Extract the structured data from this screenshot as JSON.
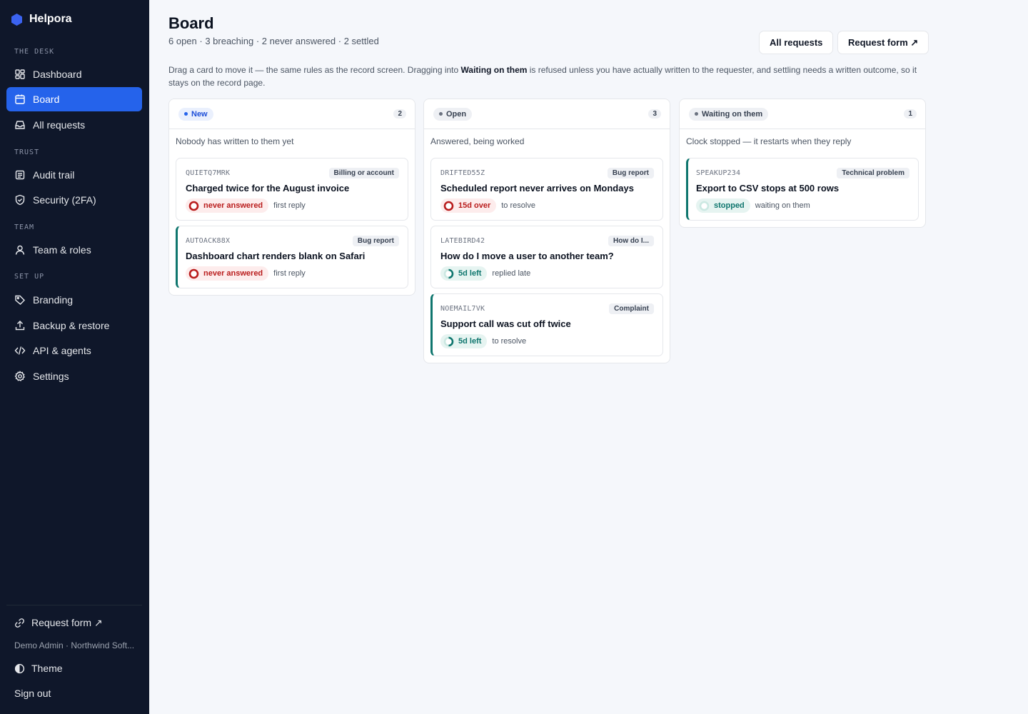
{
  "app": {
    "name": "Helpora"
  },
  "sidebar": {
    "sections": {
      "desk": "THE DESK",
      "trust": "TRUST",
      "team": "TEAM",
      "setup": "SET UP"
    },
    "items": {
      "dashboard": "Dashboard",
      "board": "Board",
      "all_requests": "All requests",
      "audit_trail": "Audit trail",
      "security": "Security (2FA)",
      "team_roles": "Team & roles",
      "branding": "Branding",
      "backup": "Backup & restore",
      "api": "API & agents",
      "settings": "Settings"
    },
    "active": "board",
    "footer": {
      "request_form": "Request form ↗",
      "user": "Demo Admin · Northwind Soft...",
      "theme": "Theme",
      "sign_out": "Sign out"
    }
  },
  "header": {
    "title": "Board",
    "subtitle": "6 open · 3 breaching · 2 never answered · 2 settled",
    "all_requests_button": "All requests",
    "request_form_button": "Request form ↗"
  },
  "intro": {
    "before": "Drag a card to move it — the same rules as the record screen. Dragging into ",
    "bold": "Waiting on them",
    "after": " is refused unless you have actually written to the requester, and settling needs a written outcome, so it stays on the record page."
  },
  "columns": [
    {
      "name": "New",
      "count": "2",
      "description": "Nobody has written to them yet",
      "cards": [
        {
          "id": "QUIETQ7MRK",
          "tag": "Billing or account",
          "title": "Charged twice for the August invoice",
          "status": "never answered",
          "note": "first reply",
          "tone": "red"
        },
        {
          "id": "AUTOACK88X",
          "tag": "Bug report",
          "title": "Dashboard chart renders blank on Safari",
          "status": "never answered",
          "note": "first reply",
          "tone": "red"
        }
      ]
    },
    {
      "name": "Open",
      "count": "3",
      "description": "Answered, being worked",
      "cards": [
        {
          "id": "DRIFTED55Z",
          "tag": "Bug report",
          "title": "Scheduled report never arrives on Mondays",
          "status": "15d over",
          "note": "to resolve",
          "tone": "red"
        },
        {
          "id": "LATEBIRD42",
          "tag": "How do I...",
          "title": "How do I move a user to another team?",
          "status": "5d left",
          "note": "replied late",
          "tone": "teal"
        },
        {
          "id": "NOEMAIL7VK",
          "tag": "Complaint",
          "title": "Support call was cut off twice",
          "status": "5d left",
          "note": "to resolve",
          "tone": "teal"
        }
      ]
    },
    {
      "name": "Waiting on them",
      "count": "1",
      "description": "Clock stopped — it restarts when they reply",
      "cards": [
        {
          "id": "SPEAKUP234",
          "tag": "Technical problem",
          "title": "Export to CSV stops at 500 rows",
          "status": "stopped",
          "note": "waiting on them",
          "tone": "teal"
        }
      ]
    }
  ],
  "colors": {
    "sidebar": "#0f172a",
    "accent": "#2563eb",
    "danger": "#b91c1c",
    "ok": "#0f766e"
  },
  "icons": [
    "hexagon-logo-icon",
    "dashboard-icon",
    "board-icon",
    "inbox-icon",
    "audit-icon",
    "shield-icon",
    "user-icon",
    "tag-icon",
    "upload-icon",
    "code-icon",
    "gear-icon",
    "link-icon",
    "theme-icon",
    "status-ring-icon"
  ]
}
